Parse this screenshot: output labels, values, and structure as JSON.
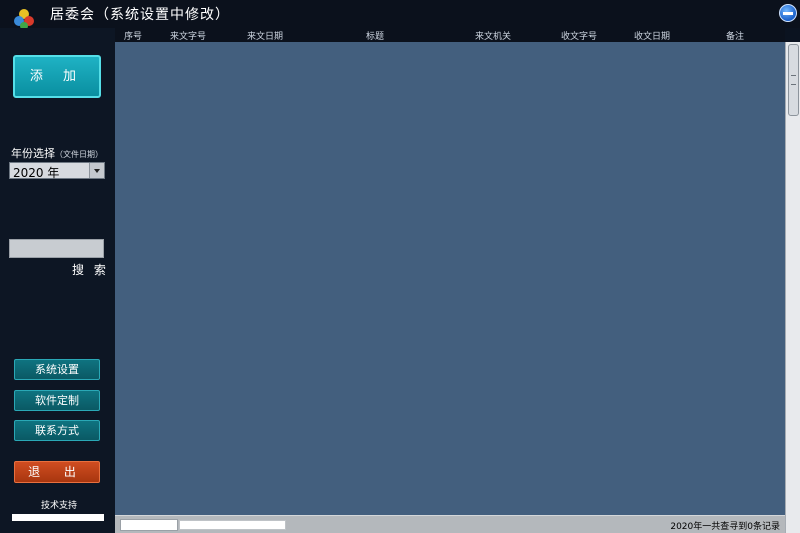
{
  "window": {
    "title": "居委会（系统设置中修改）",
    "minimize_icon": "minimize-icon",
    "logo_icon": "colored-balls-logo-icon"
  },
  "columns": [
    "序号",
    "来文字号",
    "来文日期",
    "标题",
    "来文机关",
    "收文字号",
    "收文日期",
    "备注"
  ],
  "sidebar": {
    "add_label": "添 加",
    "year_label": "年份选择",
    "year_hint": "（文件日期）",
    "year_value": "2020 年",
    "search_value": "",
    "search_label": "搜 索",
    "buttons": [
      "系统设置",
      "软件定制",
      "联系方式"
    ],
    "exit_label": "退 出",
    "support_label": "技术支持"
  },
  "status": {
    "record_count": "2020年一共查寻到0条记录"
  },
  "colors": {
    "main_background": "#435f7e",
    "sidebar_background": "#0d1624",
    "accent_teal": "#1fb2c4",
    "exit_orange": "#c84318"
  }
}
